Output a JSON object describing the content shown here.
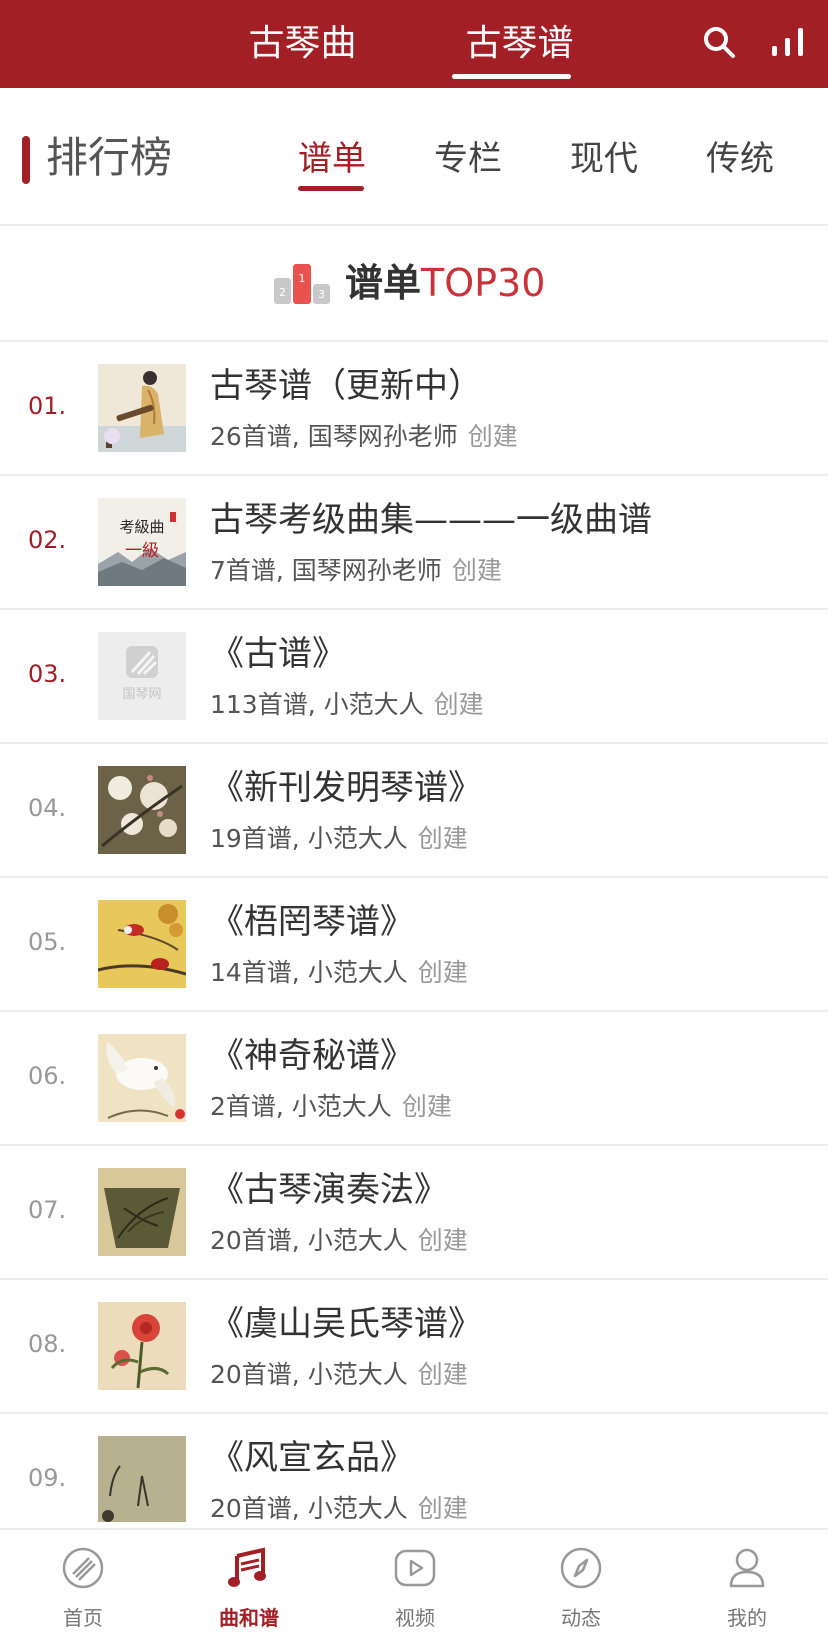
{
  "top_tabs": {
    "qin_qu": "古琴曲",
    "qin_pu": "古琴谱"
  },
  "rank_header": {
    "title": "排行榜",
    "tabs": [
      "谱单",
      "专栏",
      "现代",
      "传统"
    ],
    "active_tab": "谱单"
  },
  "top30": {
    "label_main": "谱单",
    "label_accent": "TOP30"
  },
  "items": [
    {
      "rank": "01.",
      "title": "古琴谱（更新中）",
      "meta": "26首谱, 国琴网孙老师",
      "created": "创建"
    },
    {
      "rank": "02.",
      "title": "古琴考级曲集———一级曲谱",
      "meta": "7首谱, 国琴网孙老师",
      "created": "创建"
    },
    {
      "rank": "03.",
      "title": "《古谱》",
      "meta": "113首谱, 小范大人",
      "created": "创建"
    },
    {
      "rank": "04.",
      "title": "《新刊发明琴谱》",
      "meta": "19首谱, 小范大人",
      "created": "创建"
    },
    {
      "rank": "05.",
      "title": "《梧罔琴谱》",
      "meta": "14首谱, 小范大人",
      "created": "创建"
    },
    {
      "rank": "06.",
      "title": "《神奇秘谱》",
      "meta": "2首谱, 小范大人",
      "created": "创建"
    },
    {
      "rank": "07.",
      "title": "《古琴演奏法》",
      "meta": "20首谱, 小范大人",
      "created": "创建"
    },
    {
      "rank": "08.",
      "title": "《虞山吴氏琴谱》",
      "meta": "20首谱, 小范大人",
      "created": "创建"
    },
    {
      "rank": "09.",
      "title": "《风宣玄品》",
      "meta": "20首谱, 小范大人",
      "created": "创建"
    }
  ],
  "thumb_texts": {
    "item2_line1": "考級曲",
    "item2_line2": "一級",
    "item3_logo": "国琴网"
  },
  "bottom_nav": [
    {
      "label": "首页",
      "icon": "qin-icon"
    },
    {
      "label": "曲和谱",
      "icon": "music-notes-icon"
    },
    {
      "label": "视频",
      "icon": "video-play-icon"
    },
    {
      "label": "动态",
      "icon": "compass-icon"
    },
    {
      "label": "我的",
      "icon": "person-icon"
    }
  ],
  "colors": {
    "brand": "#a31f26",
    "accent": "#c9343b"
  }
}
